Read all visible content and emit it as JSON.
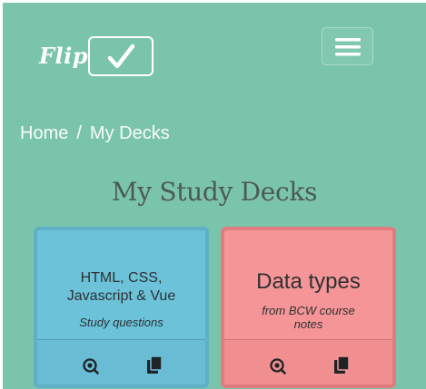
{
  "logo": {
    "text": "Flip",
    "icon": "checkmark-icon"
  },
  "header": {
    "menu_icon": "hamburger-menu-icon"
  },
  "breadcrumb": {
    "home": "Home",
    "separator": "/",
    "current": "My Decks"
  },
  "page": {
    "title": "My Study Decks"
  },
  "decks": [
    {
      "title_line1": "HTML, CSS,",
      "title_line2": "Javascript & Vue",
      "subtitle": "Study questions",
      "color": "#6bc2d9",
      "study_icon": "study-icon",
      "cards_icon": "copy-icon"
    },
    {
      "title": "Data types",
      "subtitle_line1": "from BCW course",
      "subtitle_line2": "notes",
      "color": "#f59597",
      "study_icon": "study-icon",
      "cards_icon": "copy-icon"
    }
  ],
  "colors": {
    "background": "#7bc4ac",
    "title": "#4c5a53"
  }
}
